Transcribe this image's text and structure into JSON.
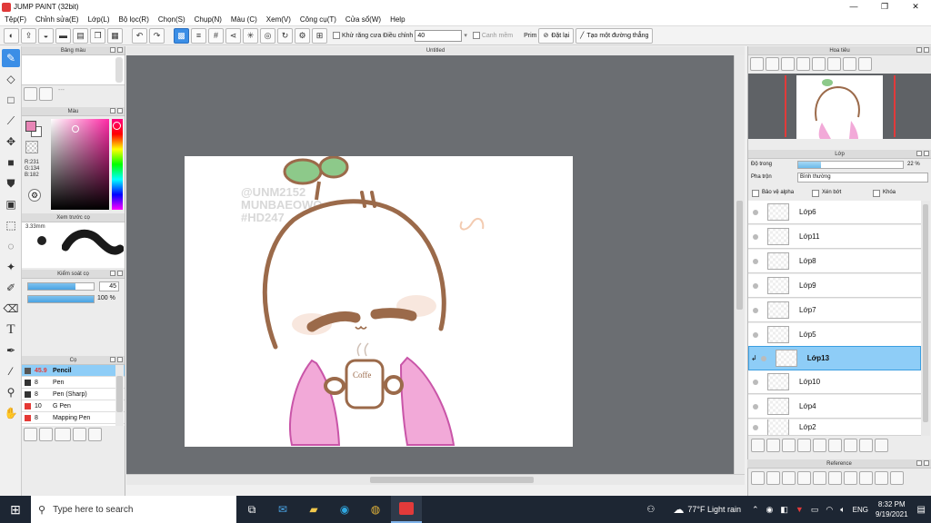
{
  "window": {
    "title": "JUMP PAINT (32bit)",
    "minimize": "—",
    "maximize": "❐",
    "close": "✕"
  },
  "menu": [
    "Tệp(F)",
    "Chỉnh sửa(E)",
    "Lớp(L)",
    "Bộ lọc(R)",
    "Chọn(S)",
    "Chụp(N)",
    "Màu (C)",
    "Xem(V)",
    "Công cụ(T)",
    "Cửa sổ(W)",
    "Help"
  ],
  "toolbar": {
    "antialias_label": "Khử răng cưa",
    "adjust_label": "Điều chỉnh",
    "adjust_value": "40",
    "smooth_label": "Canh mềm",
    "prim_label": "Prim",
    "reset_label": "Đặt lại",
    "line_label": "Tạo một đường thẳng"
  },
  "document": {
    "tab_title": "Untitled"
  },
  "left_panels": {
    "palette_title": "Bảng màu",
    "color_title": "Màu",
    "rgb": {
      "r": "R:231",
      "g": "G:134",
      "b": "B:182"
    },
    "brush_preview_title": "Xem trước cọ",
    "brush_size": "3.33mm",
    "brush_control_title": "Kiểm soát cọ",
    "brush_size_value": "45",
    "brush_opacity_value": "100 %",
    "brush_list_title": "Cọ",
    "brushes": [
      {
        "size": "45.9",
        "name": "Pencil",
        "color": "#555555",
        "selected": true
      },
      {
        "size": "8",
        "name": "Pen",
        "color": "#333333",
        "selected": false
      },
      {
        "size": "8",
        "name": "Pen (Sharp)",
        "color": "#333333",
        "selected": false
      },
      {
        "size": "10",
        "name": "G Pen",
        "color": "#e53935",
        "selected": false
      },
      {
        "size": "8",
        "name": "Mapping Pen",
        "color": "#e53935",
        "selected": false
      }
    ]
  },
  "navigator": {
    "title": "Hoa tiêu"
  },
  "layers_panel": {
    "title": "Lớp",
    "opacity_label": "Độ trong",
    "opacity_value": "22 %",
    "blend_label": "Pha trộn",
    "blend_value": "Bình thường",
    "protect_alpha": "Bảo vệ alpha",
    "clipping": "Xén bớt",
    "lock": "Khóa",
    "layers": [
      {
        "name": "Lớp6",
        "selected": false
      },
      {
        "name": "Lớp11",
        "selected": false
      },
      {
        "name": "Lớp8",
        "selected": false
      },
      {
        "name": "Lớp9",
        "selected": false
      },
      {
        "name": "Lớp7",
        "selected": false
      },
      {
        "name": "Lớp5",
        "selected": false
      },
      {
        "name": "Lớp13",
        "selected": true
      },
      {
        "name": "Lớp10",
        "selected": false
      },
      {
        "name": "Lớp4",
        "selected": false
      },
      {
        "name": "Lớp2",
        "selected": false
      }
    ]
  },
  "reference": {
    "title": "Reference"
  },
  "artwork": {
    "watermark": [
      "@UNM2152",
      "MUNBAEOWO",
      "#HD247"
    ],
    "mug_text": "Coffe"
  },
  "taskbar": {
    "search_placeholder": "Type here to search",
    "weather": "77°F  Light rain",
    "language": "ENG",
    "time": "8:32 PM",
    "date": "9/19/2021"
  },
  "colors": {
    "accent": "#3b8ee6",
    "selection": "#8ecdf7",
    "primary_color": "#e786b6",
    "canvas_bg": "#6b6e72"
  }
}
